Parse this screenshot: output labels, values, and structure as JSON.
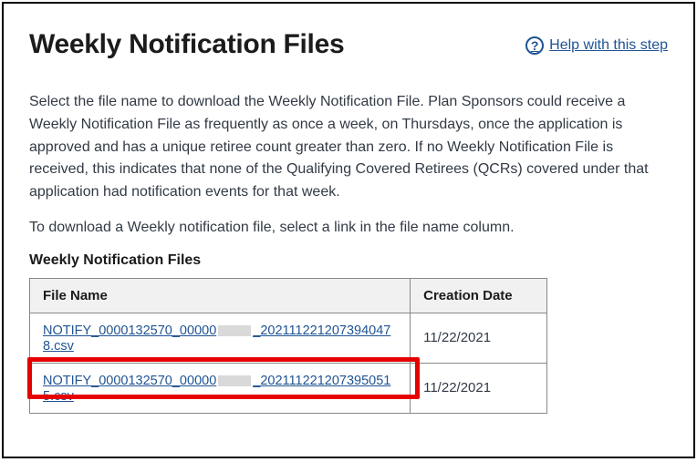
{
  "header": {
    "title": "Weekly Notification Files",
    "help_label": " Help with this step"
  },
  "intro": {
    "p1": "Select the file name to download the Weekly Notification File. Plan Sponsors could receive a Weekly Notification File as frequently as once a week, on Thursdays, once the application is approved and has a unique retiree count greater than zero. If no Weekly Notification File is received, this indicates that none of the Qualifying Covered Retirees (QCRs) covered under that application had notification events for that week.",
    "p2": "To download a Weekly notification file, select a link in the file name column."
  },
  "table": {
    "title": "Weekly Notification Files",
    "headers": {
      "file": "File Name",
      "date": "Creation Date"
    },
    "rows": [
      {
        "file_pre": "NOTIFY_0000132570_00000",
        "file_post": "_20211122120739404​78.csv",
        "date": "11/22/2021"
      },
      {
        "file_pre": "NOTIFY_0000132570_00000",
        "file_post": "_20211122120739505​15.csv",
        "date": "11/22/2021"
      }
    ]
  }
}
